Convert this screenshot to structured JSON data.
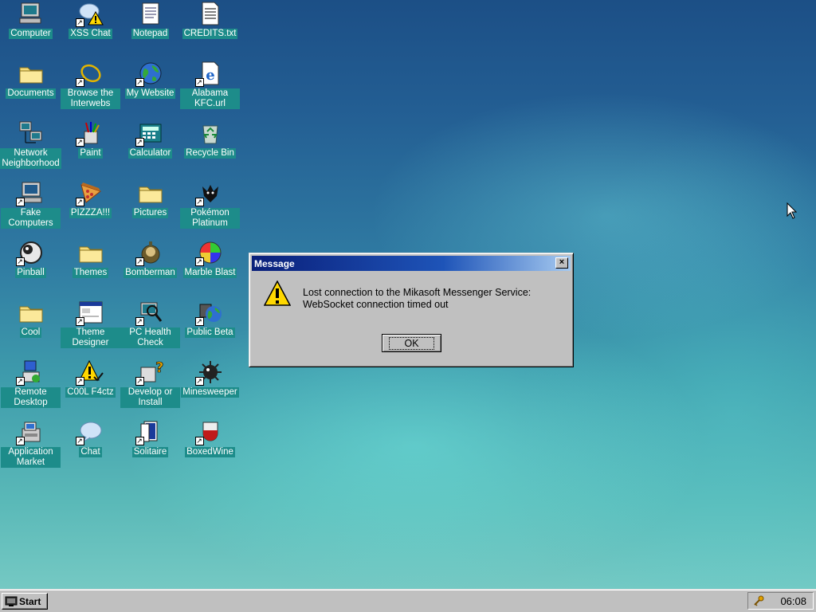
{
  "desktop": {
    "icons": [
      {
        "label": "Computer",
        "icon": "computer-icon"
      },
      {
        "label": "XSS Chat",
        "icon": "xss-chat-icon"
      },
      {
        "label": "Notepad",
        "icon": "notepad-icon"
      },
      {
        "label": "CREDITS.txt",
        "icon": "text-file-icon"
      },
      {
        "label": "Documents",
        "icon": "documents-folder-icon"
      },
      {
        "label": "Browse the Interwebs",
        "icon": "browser-icon"
      },
      {
        "label": "My Website",
        "icon": "website-globe-icon"
      },
      {
        "label": "Alabama KFC.url",
        "icon": "url-shortcut-icon"
      },
      {
        "label": "Network Neighborhood",
        "icon": "network-icon"
      },
      {
        "label": "Paint",
        "icon": "paint-icon"
      },
      {
        "label": "Calculator",
        "icon": "calculator-icon"
      },
      {
        "label": "Recycle Bin",
        "icon": "recycle-bin-icon"
      },
      {
        "label": "Fake Computers",
        "icon": "fake-computer-icon"
      },
      {
        "label": "PIZZZA!!!",
        "icon": "pizza-icon"
      },
      {
        "label": "Pictures",
        "icon": "pictures-folder-icon"
      },
      {
        "label": "Pokémon Platinum",
        "icon": "pokemon-icon"
      },
      {
        "label": "Pinball",
        "icon": "pinball-icon"
      },
      {
        "label": "Themes",
        "icon": "themes-folder-icon"
      },
      {
        "label": "Bomberman",
        "icon": "bomberman-icon"
      },
      {
        "label": "Marble Blast",
        "icon": "marble-icon"
      },
      {
        "label": "Cool",
        "icon": "cool-folder-icon"
      },
      {
        "label": "Theme Designer",
        "icon": "theme-designer-icon"
      },
      {
        "label": "PC Health Check",
        "icon": "health-check-icon"
      },
      {
        "label": "Public Beta",
        "icon": "public-beta-icon"
      },
      {
        "label": "Remote Desktop",
        "icon": "remote-desktop-icon"
      },
      {
        "label": "C00L F4ctz",
        "icon": "cool-facts-icon"
      },
      {
        "label": "Develop or Install",
        "icon": "develop-install-icon"
      },
      {
        "label": "Minesweeper",
        "icon": "minesweeper-icon"
      },
      {
        "label": "Application Market",
        "icon": "app-market-icon"
      },
      {
        "label": "Chat",
        "icon": "chat-icon"
      },
      {
        "label": "Solitaire",
        "icon": "solitaire-icon"
      },
      {
        "label": "BoxedWine",
        "icon": "boxedwine-icon"
      }
    ]
  },
  "dialog": {
    "title": "Message",
    "close_label": "×",
    "message_line1": "Lost connection to the Mikasoft Messenger Service:",
    "message_line2": "WebSocket connection timed out",
    "ok_label": "OK",
    "icon": "warning-icon"
  },
  "taskbar": {
    "start_label": "Start",
    "clock": "06:08"
  },
  "colors": {
    "label_bg": "#1d8c8a",
    "title_bar_start": "#0a1f7a",
    "title_bar_end": "#a6caf0",
    "face": "#c0c0c0"
  }
}
